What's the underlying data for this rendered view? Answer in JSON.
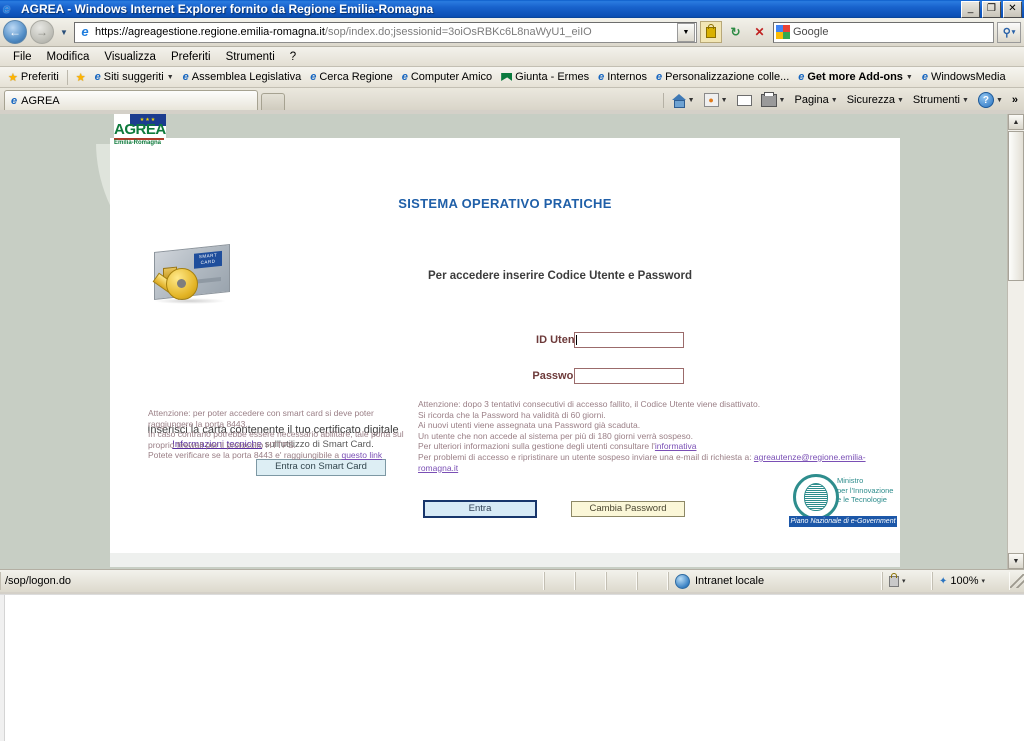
{
  "window": {
    "title": "AGREA - Windows Internet Explorer fornito da Regione Emilia-Romagna",
    "minimize": "_",
    "restore": "❐",
    "close": "✕"
  },
  "address": {
    "url_dark": "https://agreagestione.regione.emilia-romagna.it",
    "url_gray": "/sop/index.do;jsessionid=3oiOsRBKc6L8naWyU1_eiIO",
    "dropdown_icon": "▼",
    "lock_icon": "lock-icon",
    "refresh_icon": "↻",
    "stop_icon": "✕",
    "search_value": "Google",
    "search_icon": "⚲",
    "search_dropdown": "▾"
  },
  "menu": {
    "items": [
      "File",
      "Modifica",
      "Visualizza",
      "Preferiti",
      "Strumenti",
      "?"
    ]
  },
  "favorites": {
    "button": "Preferiti",
    "items": [
      {
        "label": "Siti suggeriti",
        "icon": "ie-icon",
        "caret": true
      },
      {
        "label": "Assemblea Legislativa",
        "icon": "ie-icon",
        "caret": false
      },
      {
        "label": "Cerca Regione",
        "icon": "ie-icon",
        "caret": false
      },
      {
        "label": "Computer Amico",
        "icon": "ie-icon",
        "caret": false
      },
      {
        "label": "Giunta - Ermes",
        "icon": "flag-icon",
        "caret": false
      },
      {
        "label": "Internos",
        "icon": "ie-icon",
        "caret": false
      },
      {
        "label": "Personalizzazione colle...",
        "icon": "ie-icon",
        "caret": false
      },
      {
        "label": "Get more Add-ons",
        "icon": "ie-icon",
        "caret": true
      },
      {
        "label": "WindowsMedia",
        "icon": "ie-icon",
        "caret": false
      }
    ]
  },
  "tabs": {
    "active": "AGREA",
    "new_tab_tooltip": ""
  },
  "commandbar": {
    "items": [
      {
        "label": "",
        "icon": "home-icon",
        "caret": true
      },
      {
        "label": "",
        "icon": "rss-icon",
        "caret": true
      },
      {
        "label": "",
        "icon": "mail-icon",
        "caret": false
      },
      {
        "label": "",
        "icon": "print-icon",
        "caret": true
      },
      {
        "label": "Pagina",
        "icon": "",
        "caret": true
      },
      {
        "label": "Sicurezza",
        "icon": "",
        "caret": true
      },
      {
        "label": "Strumenti",
        "icon": "",
        "caret": true
      },
      {
        "label": "",
        "icon": "help-icon",
        "caret": true
      }
    ],
    "overflow": "»"
  },
  "page": {
    "logo": {
      "word": "AGREA",
      "sub": "Emilia-Romagna",
      "eu_stars": "★★★"
    },
    "heading": "SISTEMA OPERATIVO PRATICHE",
    "instruction": "Per accedere inserire Codice Utente e Password",
    "smartcard": {
      "card_label": "SMART CARD",
      "caption": "Inserisci la carta contenente il tuo certificato digitale",
      "caption2_link": "Informazioni tecniche",
      "caption2_rest": " sull'utilizzo di Smart Card.",
      "button": "Entra con Smart Card"
    },
    "form": {
      "id_label": "ID Utente:",
      "id_value": "",
      "password_label": "Password:",
      "password_value": "",
      "entra_button": "Entra",
      "cambia_button": "Cambia Password"
    },
    "notice_left": {
      "line1": "Attenzione: per poter accedere con smart card si deve poter",
      "line2": "raggiungere la porta 8443.",
      "line3": "In caso contrario potrebbe essere necessario abilitare, tale porta sul",
      "line4": "proprio firewall per il protocollo HTTPS.",
      "line5_pre": "Potete verificare se la porta 8443 e' raggiungibile a ",
      "line5_link": "questo link"
    },
    "notice_right": {
      "line1": "Attenzione: dopo 3 tentativi consecutivi di accesso fallito, il Codice Utente viene disattivato.",
      "line2": "Si ricorda che la Password ha validità di 60 giorni.",
      "line3": "Ai nuovi utenti viene assegnata una Password già scaduta.",
      "line4": "Un utente che non accede al sistema per più di 180 giorni verrà sospeso.",
      "line5_pre": "Per ulteriori informazioni sulla gestione degli utenti consultare l'",
      "line5_link": "informativa",
      "line6_pre": "Per problemi di accesso e ripristinare un utente sospeso inviare una e-mail di richiesta a: ",
      "line6_link": "agreautenze@regione.emilia-romagna.it"
    },
    "ministry": {
      "line1": "Ministro",
      "line2": "per l'Innovazione",
      "line3": "e le Tecnologie",
      "banner": "Piano Nazionale di e-Government"
    }
  },
  "statusbar": {
    "url": "/sop/logon.do",
    "zone": "Intranet locale",
    "zoom": "100%",
    "zoom_caret": "▾",
    "security_caret": "▾"
  },
  "colors": {
    "title_blue": "#1862cc",
    "page_bg": "#c7cec4",
    "heading_blue": "#1f5fa8",
    "label_brown": "#6d3a3a",
    "notice_mauve": "#9a7f86",
    "link_purple": "#5a2fa0",
    "entra_fill": "#d7eaf6",
    "cambia_fill": "#fbf7d8",
    "agrea_green": "#0e7a3c",
    "ministry_teal": "#2e8d8d"
  }
}
